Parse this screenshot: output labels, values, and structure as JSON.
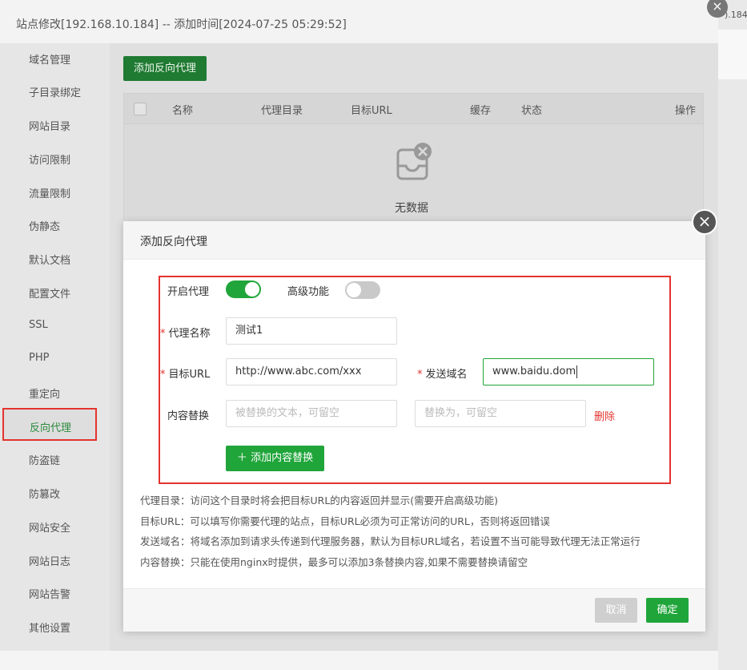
{
  "window": {
    "title": "站点修改[192.168.10.184] -- 添加时间[2024-07-25 05:29:52]",
    "right_edge_text": ").184"
  },
  "sidebar": {
    "items": [
      {
        "label": "域名管理"
      },
      {
        "label": "子目录绑定"
      },
      {
        "label": "网站目录"
      },
      {
        "label": "访问限制"
      },
      {
        "label": "流量限制"
      },
      {
        "label": "伪静态"
      },
      {
        "label": "默认文档"
      },
      {
        "label": "配置文件"
      },
      {
        "label": "SSL"
      },
      {
        "label": "PHP"
      },
      {
        "label": "重定向"
      },
      {
        "label": "反向代理",
        "active": true
      },
      {
        "label": "防盗链"
      },
      {
        "label": "防篡改"
      },
      {
        "label": "网站安全"
      },
      {
        "label": "网站日志"
      },
      {
        "label": "网站告警"
      },
      {
        "label": "其他设置"
      }
    ]
  },
  "proxy_page": {
    "add_button": "添加反向代理",
    "columns": [
      "名称",
      "代理目录",
      "目标URL",
      "缓存",
      "状态",
      "操作"
    ],
    "empty_text": "无数据"
  },
  "modal": {
    "title": "添加反向代理",
    "enable_proxy_label": "开启代理",
    "enable_proxy_on": true,
    "advanced_label": "高级功能",
    "advanced_on": false,
    "name_label": "代理名称",
    "name_value": "测试1",
    "target_url_label": "目标URL",
    "target_url_value": "http://www.abc.com/xxx",
    "send_domain_label": "发送域名",
    "send_domain_value": "www.baidu.dom",
    "content_replace_label": "内容替换",
    "replace_from_placeholder": "被替换的文本，可留空",
    "replace_to_placeholder": "替换为，可留空",
    "delete_label": "删除",
    "add_replace_button": "添加内容替换",
    "help": [
      "代理目录：访问这个目录时将会把目标URL的内容返回并显示(需要开启高级功能)",
      "目标URL：可以填写你需要代理的站点，目标URL必须为可正常访问的URL，否则将返回错误",
      "发送域名：将域名添加到请求头传递到代理服务器，默认为目标URL域名，若设置不当可能导致代理无法正常运行",
      "内容替换：只能在使用nginx时提供，最多可以添加3条替换内容,如果不需要替换请留空"
    ],
    "cancel_button": "取消",
    "confirm_button": "确定"
  },
  "colors": {
    "accent": "#20a53a",
    "danger": "#e3342f",
    "toggle_off": "#c9c9c9"
  },
  "icons": {
    "close": "close-icon",
    "empty": "empty-box-icon",
    "plus": "plus-icon"
  }
}
